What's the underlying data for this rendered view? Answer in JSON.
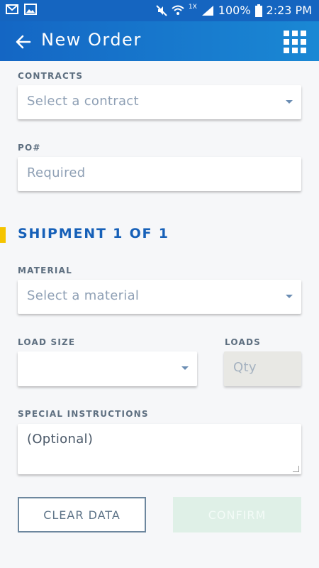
{
  "status_bar": {
    "battery": "100%",
    "time": "2:23 PM",
    "network_sup": "1X"
  },
  "appbar": {
    "title": "New Order"
  },
  "contracts": {
    "label": "CONTRACTS",
    "placeholder": "Select a contract"
  },
  "po": {
    "label": "PO#",
    "placeholder": "Required"
  },
  "shipment": {
    "title": "SHIPMENT 1 OF 1"
  },
  "material": {
    "label": "MATERIAL",
    "placeholder": "Select a material"
  },
  "load_size": {
    "label": "LOAD SIZE",
    "value": ""
  },
  "loads": {
    "label": "LOADS",
    "placeholder": "Qty"
  },
  "instructions": {
    "label": "SPECIAL INSTRUCTIONS",
    "placeholder": "(Optional)"
  },
  "buttons": {
    "clear": "CLEAR DATA",
    "confirm": "CONFIRM"
  },
  "colors": {
    "appbar": "#1466c4",
    "accent_section": "#f5c400",
    "section_title": "#1660b8",
    "confirm_disabled": "#dff0e7"
  }
}
